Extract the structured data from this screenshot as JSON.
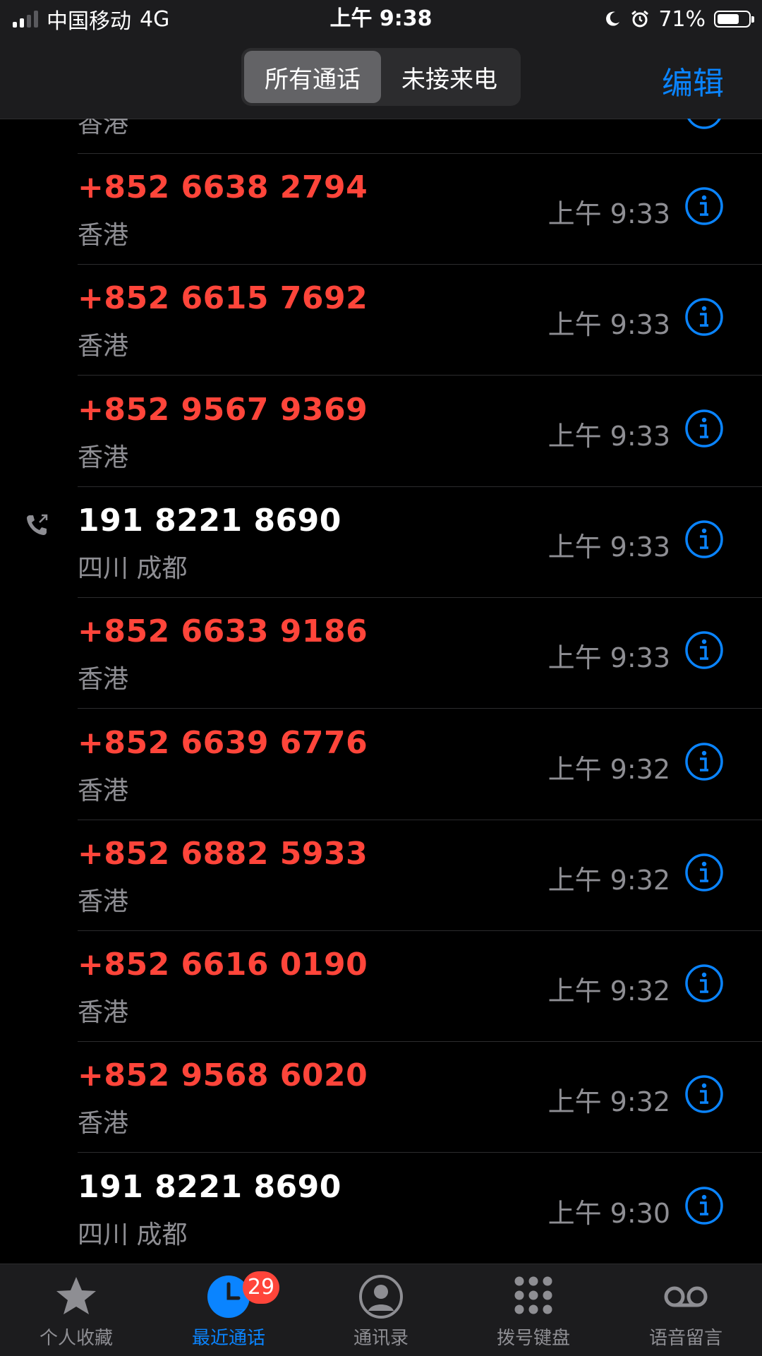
{
  "status_bar": {
    "carrier": "中国移动",
    "network": "4G",
    "time": "上午 9:38",
    "battery_percent": "71%",
    "battery_level": 0.71
  },
  "header": {
    "segments": [
      "所有通话",
      "未接来电"
    ],
    "selected_segment": 0,
    "edit_label": "编辑"
  },
  "partial_top_row": {
    "location": "香港"
  },
  "calls": [
    {
      "number": "+852 6638 2794",
      "location": "香港",
      "time": "上午 9:33",
      "missed": true,
      "outgoing": false
    },
    {
      "number": "+852 6615 7692",
      "location": "香港",
      "time": "上午 9:33",
      "missed": true,
      "outgoing": false
    },
    {
      "number": "+852 9567 9369",
      "location": "香港",
      "time": "上午 9:33",
      "missed": true,
      "outgoing": false
    },
    {
      "number": "191 8221 8690",
      "location": "四川 成都",
      "time": "上午 9:33",
      "missed": false,
      "outgoing": true
    },
    {
      "number": "+852 6633 9186",
      "location": "香港",
      "time": "上午 9:33",
      "missed": true,
      "outgoing": false
    },
    {
      "number": "+852 6639 6776",
      "location": "香港",
      "time": "上午 9:32",
      "missed": true,
      "outgoing": false
    },
    {
      "number": "+852 6882 5933",
      "location": "香港",
      "time": "上午 9:32",
      "missed": true,
      "outgoing": false
    },
    {
      "number": "+852 6616 0190",
      "location": "香港",
      "time": "上午 9:32",
      "missed": true,
      "outgoing": false
    },
    {
      "number": "+852 9568 6020",
      "location": "香港",
      "time": "上午 9:32",
      "missed": true,
      "outgoing": false
    },
    {
      "number": "191 8221 8690",
      "location": "四川 成都",
      "time": "上午 9:30",
      "missed": false,
      "outgoing": false
    }
  ],
  "tab_bar": {
    "tabs": [
      {
        "label": "个人收藏",
        "icon": "star-icon"
      },
      {
        "label": "最近通话",
        "icon": "clock-icon",
        "badge": "29"
      },
      {
        "label": "通讯录",
        "icon": "person-circle-icon"
      },
      {
        "label": "拨号键盘",
        "icon": "keypad-icon"
      },
      {
        "label": "语音留言",
        "icon": "voicemail-icon"
      }
    ],
    "active_index": 1
  },
  "colors": {
    "accent": "#0a84ff",
    "missed": "#ff453a",
    "secondary_text": "#8e8e93",
    "bar_background": "#1c1c1e"
  }
}
